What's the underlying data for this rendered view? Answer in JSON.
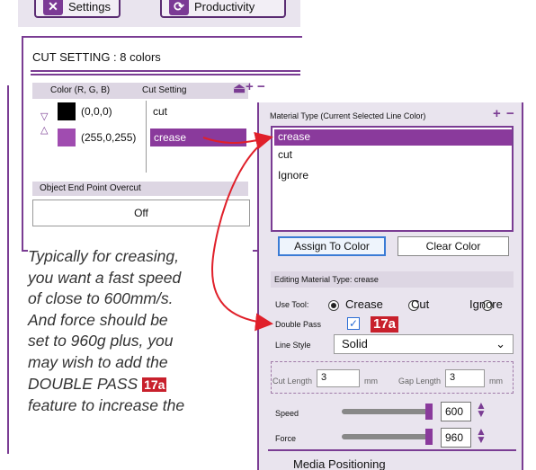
{
  "toolbar": {
    "settings_label": "Settings",
    "productivity_label": "Productivity"
  },
  "cut_setting": {
    "title": "CUT SETTING : 8 colors",
    "col_color": "Color (R, G, B)",
    "col_cut": "Cut Setting",
    "rows": [
      {
        "rgb": "(0,0,0)",
        "setting": "cut",
        "swatch": "#000000"
      },
      {
        "rgb": "(255,0,255)",
        "setting": "crease",
        "swatch": "#a04cb0"
      }
    ],
    "overcut_label": "Object End Point Overcut",
    "overcut_value": "Off"
  },
  "material": {
    "title": "Material Type (Current Selected Line Color)",
    "items": [
      "crease",
      "cut",
      "Ignore"
    ],
    "assign_label": "Assign To Color",
    "clear_label": "Clear Color",
    "editing_label": "Editing Material Type: crease",
    "use_tool_label": "Use Tool:",
    "tools": [
      "Crease",
      "Cut",
      "Ignore"
    ],
    "double_pass_label": "Double Pass",
    "badge": "17a",
    "line_style_label": "Line Style",
    "line_style_value": "Solid",
    "cut_length_label": "Cut Length",
    "cut_length_value": "3",
    "gap_length_label": "Gap Length",
    "gap_length_value": "3",
    "unit": "mm",
    "speed_label": "Speed",
    "speed_value": "600",
    "force_label": "Force",
    "force_value": "960",
    "media_label": "Media Positioning"
  },
  "note": {
    "lines": [
      "Typically for creasing,",
      "you want a fast speed",
      "of close to 600mm/s.",
      "And force should be",
      "set to 960g plus, you",
      "may wish to add the",
      "DOUBLE PASS",
      "feature to increase the"
    ],
    "badge": "17a"
  },
  "colors": {
    "accent": "#7a3c93",
    "selected": "#8a3a9c",
    "arrow": "#e0202a",
    "badge": "#c8202c"
  }
}
